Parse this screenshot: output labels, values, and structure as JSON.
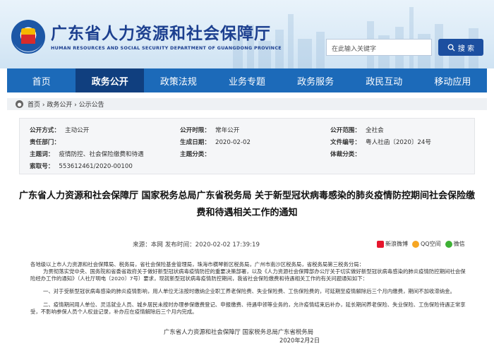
{
  "header": {
    "title": "广东省人力资源和社会保障厅",
    "subtitle": "HUMAN RESOURCES AND SOCIAL SECURITY DEPARTMENT OF GUANGDONG PROVINCE",
    "search_placeholder": "在此输入关键字",
    "search_button": "搜 索"
  },
  "nav": [
    "首页",
    "政务公开",
    "政策法规",
    "业务专题",
    "政务服务",
    "政民互动",
    "移动应用"
  ],
  "breadcrumb": "首页 › 政务公开 › 公示公告",
  "meta": {
    "open_mode_label": "公开方式：",
    "open_mode": "主动公开",
    "open_period_label": "公开时限：",
    "open_period": "常年公开",
    "open_scope_label": "公开范围：",
    "open_scope": "全社会",
    "owner_label": "责任部门：",
    "owner": "",
    "date_label": "生成日期：",
    "date": "2020-02-02",
    "doc_no_label": "文件编号：",
    "doc_no": "粤人社函〔2020〕24号",
    "topic_label": "主题词：",
    "topic": "疫情防控、社会保险缴费和待遇",
    "category_label": "主题分类：",
    "category": "",
    "genre_label": "体裁分类：",
    "genre": "",
    "index_label": "索取号：",
    "index": "553612461/2020-00100"
  },
  "article": {
    "title_line1": "广东省人力资源和社会保障厅 国家税务总局广东省税务局 关于新型冠状病毒感染的肺炎疫情防控期间社会保险缴",
    "title_line2": "费和待遇相关工作的通知",
    "source": "来源：本网   发布时间：2020-02-02 17:39:19",
    "share": [
      "新浪微博",
      "QQ空间",
      "微信"
    ],
    "addressee": "各地级以上市人力资源和社会保障局、税务局，省社会保险基金管理局，珠海市横琴新区税务局，广州市南沙区税务局，省税务局第三税务分局：",
    "para1": "为贯彻落实党中央、国务院和省委省政府关于做好新型冠状病毒疫情防控的重要决策部署，以及《人力资源社会保障部办公厅关于切实做好新型冠状病毒感染的肺炎疫情防控期间社会保险经办工作的通知》（人社厅明电〔2020〕7号）要求，现就新型冠状病毒疫情防控期间，我省社会保险缴费和待遇相关工作的有关问题通知如下：",
    "para2": "一、对于受新型冠状病毒感染的肺炎疫情影响，用人单位无法按时缴纳企业职工养老保险费、失业保险费、工伤保险费的，可延期至疫情解除后三个月内缴费，期间不加收滞纳金。",
    "para3": "二、疫情期间用人单位、灵活就业人员、城乡居民未按时办理参保缴费登记、申报缴费、待遇申领等业务的，允许疫情结束后补办，延长期间养老保险、失业保险、工伤保险待遇正常享受，不影响参保人员个人权益记录，补办应在疫情解除后三个月内完成。",
    "sign": "广东省人力资源和社会保障厅      国家税务总局广东省税务局",
    "sign_date": "2020年2月2日"
  },
  "colors": {
    "brand": "#1c4fa0",
    "nav": "#1c6ab9",
    "nav_active": "#103f7f"
  }
}
